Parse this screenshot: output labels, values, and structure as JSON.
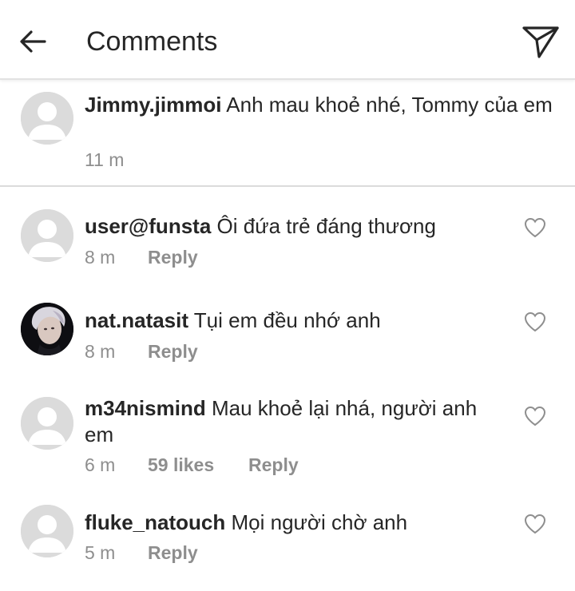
{
  "header": {
    "title": "Comments",
    "back_icon": "arrow-left-icon",
    "send_icon": "paper-plane-icon"
  },
  "caption": {
    "username": "Jimmy.jimmoi",
    "text": "Anh mau khoẻ nhé, Tommy của em",
    "time": "11 m"
  },
  "comments": [
    {
      "username": "user@funsta",
      "text": "Ôi đứa trẻ đáng thương",
      "time": "8 m",
      "likes": "",
      "reply": "Reply",
      "avatar": "default"
    },
    {
      "username": "nat.natasit",
      "text": "Tụi em đều nhớ anh",
      "time": "8 m",
      "likes": "",
      "reply": "Reply",
      "avatar": "photo"
    },
    {
      "username": "m34nismind",
      "text": "Mau khoẻ lại nhá, người anh em",
      "time": "6 m",
      "likes": "59 likes",
      "reply": "Reply",
      "avatar": "default"
    },
    {
      "username": "fluke_natouch",
      "text": "Mọi người chờ anh",
      "time": "5 m",
      "likes": "",
      "reply": "Reply",
      "avatar": "default"
    }
  ],
  "colors": {
    "text": "#262626",
    "secondary": "#8e8e8e",
    "divider": "#dbdbdb",
    "avatar_bg": "#dbdbdb"
  }
}
